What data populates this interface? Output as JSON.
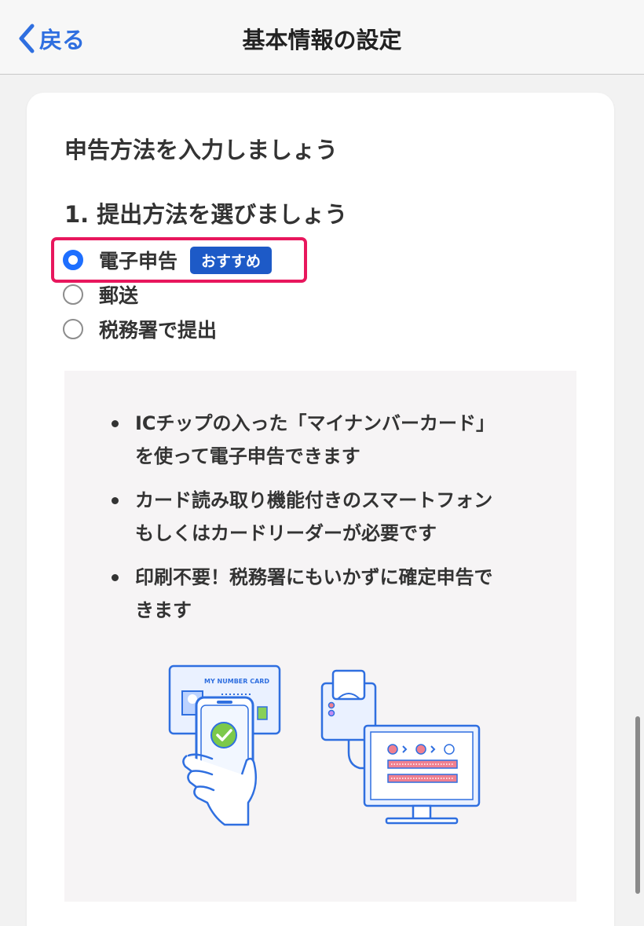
{
  "navbar": {
    "back_label": "戻る",
    "title": "基本情報の設定"
  },
  "card": {
    "heading": "申告方法を入力しましょう",
    "subheading": "1. 提出方法を選びましょう",
    "options": [
      {
        "label": "電子申告",
        "badge": "おすすめ",
        "selected": true
      },
      {
        "label": "郵送",
        "selected": false
      },
      {
        "label": "税務署で提出",
        "selected": false
      }
    ],
    "info": {
      "bullets": [
        {
          "line1": "ICチップの入った「マイナンバーカード」",
          "line2": "を使って電子申告できます"
        },
        {
          "line1": "カード読み取り機能付きのスマートフォン",
          "line2": "もしくはカードリーダーが必要です"
        },
        {
          "line1": "印刷不要！税務署にもいかずに確定申告で",
          "line2": "きます"
        }
      ],
      "illustration_card_text": "MY NUMBER CARD"
    }
  },
  "colors": {
    "accent": "#1e6fff",
    "badge": "#1d5ac7",
    "highlight": "#e8175d",
    "back_link": "#2f6fe0"
  },
  "icons": [
    "chevron-left-icon",
    "check-icon",
    "phone-card-reader-illustration",
    "card-reader-computer-illustration"
  ]
}
